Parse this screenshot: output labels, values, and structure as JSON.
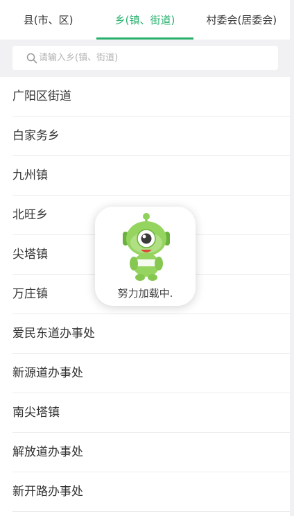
{
  "tabs": [
    {
      "label": "县(市、区)",
      "active": false
    },
    {
      "label": "乡(镇、街道)",
      "active": true
    },
    {
      "label": "村委会(居委会)",
      "active": false
    }
  ],
  "accent_color": "#27b06c",
  "search": {
    "placeholder": "请输入乡(镇、街道)",
    "value": "",
    "icon": "search-icon"
  },
  "items": [
    "广阳区街道",
    "白家务乡",
    "九州镇",
    "北旺乡",
    "尖塔镇",
    "万庄镇",
    "爱民东道办事处",
    "新源道办事处",
    "南尖塔镇",
    "解放道办事处",
    "新开路办事处"
  ],
  "loading": {
    "text": "努力加载中.",
    "mascot": "green-robot-mascot"
  }
}
